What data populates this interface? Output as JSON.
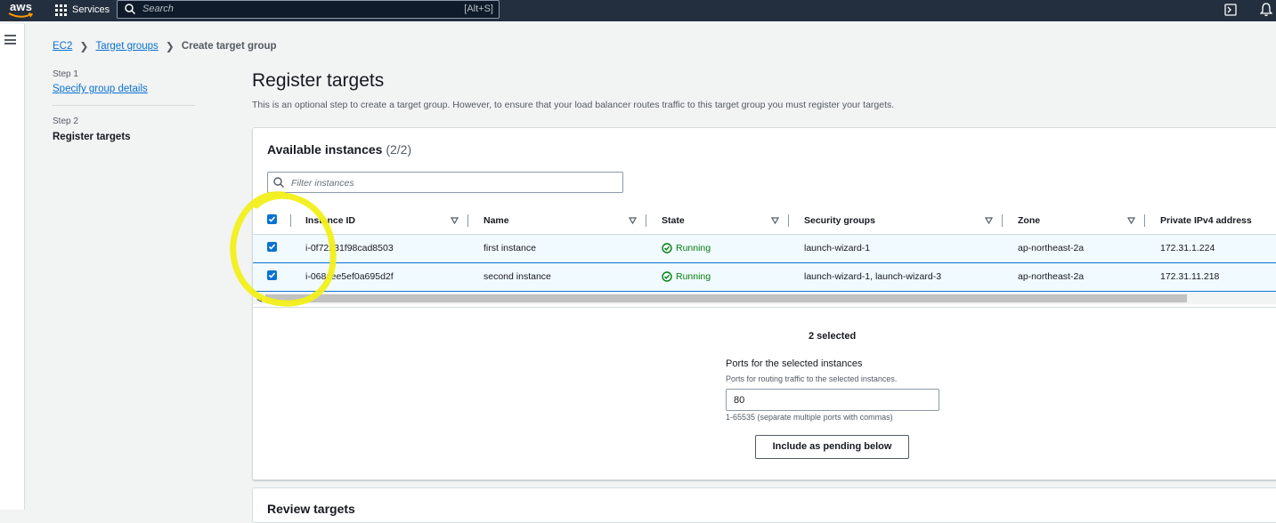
{
  "topbar": {
    "logo_text": "aws",
    "services_label": "Services",
    "search_placeholder": "Search",
    "search_shortcut": "[Alt+S]"
  },
  "breadcrumb": {
    "items": [
      "EC2",
      "Target groups"
    ],
    "current": "Create target group"
  },
  "steps": [
    {
      "number": "Step 1",
      "label": "Specify group details"
    },
    {
      "number": "Step 2",
      "label": "Register targets"
    }
  ],
  "page": {
    "title": "Register targets",
    "description": "This is an optional step to create a target group. However, to ensure that your load balancer routes traffic to this target group you must register your targets."
  },
  "instances": {
    "title": "Available instances",
    "count": "(2/2)",
    "filter_placeholder": "Filter instances",
    "columns": [
      "Instance ID",
      "Name",
      "State",
      "Security groups",
      "Zone",
      "Private IPv4 address"
    ],
    "rows": [
      {
        "id": "i-0f72231f98cad8503",
        "name": "first instance",
        "state": "Running",
        "sg": "launch-wizard-1",
        "zone": "ap-northeast-2a",
        "ip": "172.31.1.224"
      },
      {
        "id": "i-068cee5ef0a695d2f",
        "name": "second instance",
        "state": "Running",
        "sg": "launch-wizard-1, launch-wizard-3",
        "zone": "ap-northeast-2a",
        "ip": "172.31.11.218"
      }
    ]
  },
  "selection": {
    "selected_text": "2 selected",
    "ports_label": "Ports for the selected instances",
    "ports_desc": "Ports for routing traffic to the selected instances.",
    "ports_value": "80",
    "ports_hint": "1-65535 (separate multiple ports with commas)",
    "include_button": "Include as pending below"
  },
  "review": {
    "title": "Review targets"
  },
  "colors": {
    "topbar": "#232f3e",
    "link": "#0972d3",
    "running": "#037f0c",
    "highlight": "#f2ef1a"
  }
}
